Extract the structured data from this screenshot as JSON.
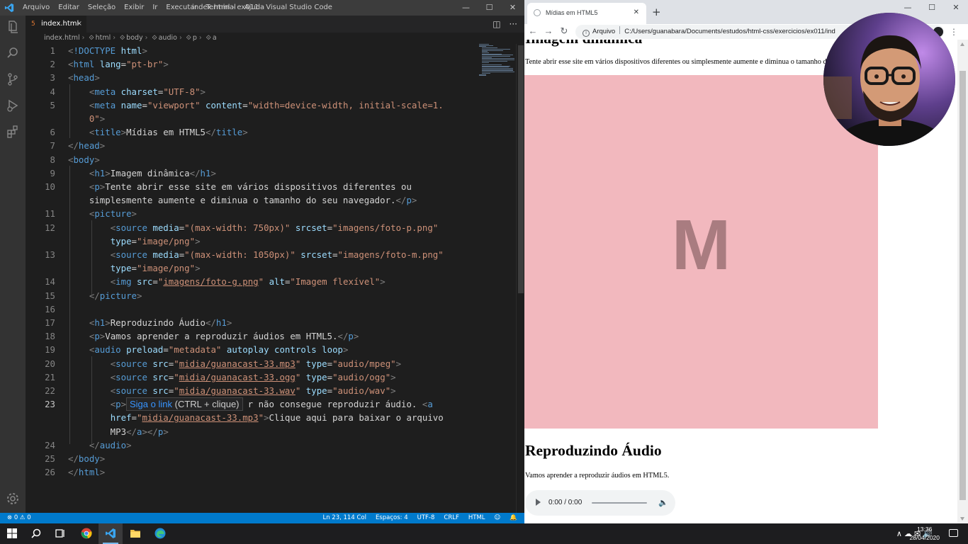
{
  "vscode": {
    "menu": [
      "Arquivo",
      "Editar",
      "Seleção",
      "Exibir",
      "Ir",
      "Executar",
      "Terminal",
      "Ajuda"
    ],
    "window_title": "index.html - ex011 - Visual Studio Code",
    "window_controls": {
      "minimize": "—",
      "maximize": "☐",
      "close": "✕"
    },
    "activity_icons": [
      "explorer-icon",
      "search-icon",
      "source-control-icon",
      "run-debug-icon",
      "extensions-icon",
      "settings-gear-icon"
    ],
    "tab": {
      "label": "index.html",
      "close": "×"
    },
    "tab_actions": {
      "split": "◫",
      "more": "···"
    },
    "breadcrumb": [
      "index.html",
      "html",
      "body",
      "audio",
      "p",
      "a"
    ],
    "line_numbers": [
      "1",
      "2",
      "3",
      "4",
      "5",
      "6",
      "7",
      "8",
      "9",
      "10",
      "11",
      "12",
      "13",
      "14",
      "15",
      "16",
      "17",
      "18",
      "19",
      "20",
      "21",
      "22",
      "23",
      "24",
      "25",
      "26"
    ],
    "active_line": "23",
    "hover_tooltip": {
      "link": "Siga o link",
      "hint": "(CTRL + clique)"
    },
    "status": {
      "problems": "⊗ 0 ⚠ 0",
      "position": "Ln 23, 114 Col",
      "spaces": "Espaços: 4",
      "encoding": "UTF-8",
      "eol": "CRLF",
      "language": "HTML",
      "feedback": "☺",
      "bell": "🔔"
    }
  },
  "browser": {
    "tab_title": "Mídias em HTML5",
    "tab_close": "✕",
    "new_tab": "+",
    "nav": {
      "back": "←",
      "forward": "→",
      "reload": "↻",
      "menu": "⋮"
    },
    "address": {
      "label": "Arquivo",
      "url": "C:/Users/guanabara/Documents/estudos/html-css/exercicios/ex011/ind"
    },
    "window_controls": {
      "minimize": "—",
      "maximize": "☐",
      "close": "✕"
    },
    "page": {
      "h1_top": "Imagem dinâmica",
      "p1": "Tente abrir esse site em vários dispositivos diferentes ou simplesmente aumente e diminua o tamanho do seu navegador.",
      "image_letter": "M",
      "h1_audio": "Reproduzindo Áudio",
      "p2": "Vamos aprender a reproduzir áudios em HTML5.",
      "audio_time": "0:00 / 0:00"
    }
  },
  "taskbar": {
    "apps": [
      "windows-start-icon",
      "search-icon",
      "task-view-icon",
      "chrome-icon",
      "vscode-icon",
      "file-explorer-icon",
      "edge-icon"
    ],
    "tray_icons": "∧  ☁  ✉  🔊",
    "time": "13:36",
    "date": "28/04/2020"
  },
  "colors": {
    "vscode_bg": "#1e1e1e",
    "statusbar": "#007acc",
    "image_pink": "#f2b8be",
    "tag_blue": "#569cd6",
    "attr_lightblue": "#9cdcfe",
    "string_orange": "#ce9178"
  }
}
